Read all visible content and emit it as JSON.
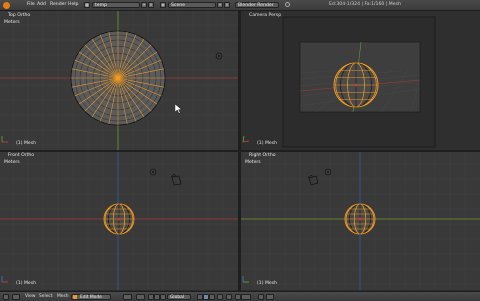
{
  "header": {
    "menus": [
      "File",
      "Add",
      "Render",
      "Help"
    ],
    "screen_layout": "temp",
    "scene": "Scene",
    "render_engine": "Blender Render",
    "stats": "Ed:304-1/324 | Fa:1/160 | Mesh"
  },
  "viewports": {
    "top_left": {
      "title": "Top Ortho",
      "units": "Meters",
      "object": "(1) Mesh"
    },
    "top_right": {
      "title": "Camera Persp",
      "object": "(1) Mesh"
    },
    "bottom_left": {
      "title": "Front Ortho",
      "units": "Meters",
      "object": "(1) Mesh"
    },
    "bottom_right": {
      "title": "Right Ortho",
      "units": "Meters",
      "object": "(1) Mesh"
    }
  },
  "footer": {
    "menus": [
      "View",
      "Select",
      "Mesh"
    ],
    "mode": "Edit Mode",
    "pivot": "Global"
  },
  "colors": {
    "viewport_bg": "#393939",
    "wire": "#1a1a1a",
    "selected": "#f39a1c",
    "x_axis": "#a23a3a",
    "y_axis": "#6f9a2e"
  }
}
